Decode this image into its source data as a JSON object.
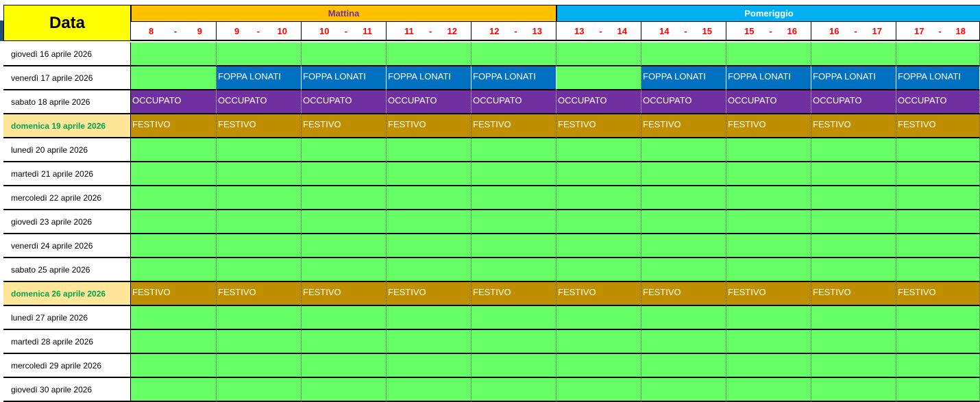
{
  "header": {
    "data_label": "Data",
    "groups": [
      {
        "label": "Mattina",
        "bg": "#ffc000",
        "color": "#7030a0"
      },
      {
        "label": "Pomeriggio",
        "bg": "#00b0f0",
        "color": "#ffffff"
      }
    ],
    "hours": [
      {
        "from": "8",
        "sep": "-",
        "to": "9"
      },
      {
        "from": "9",
        "sep": "-",
        "to": "10"
      },
      {
        "from": "10",
        "sep": "-",
        "to": "11"
      },
      {
        "from": "11",
        "sep": "-",
        "to": "12"
      },
      {
        "from": "12",
        "sep": "-",
        "to": "13"
      },
      {
        "from": "13",
        "sep": "-",
        "to": "14"
      },
      {
        "from": "14",
        "sep": "-",
        "to": "15"
      },
      {
        "from": "15",
        "sep": "-",
        "to": "16"
      },
      {
        "from": "16",
        "sep": "-",
        "to": "17"
      },
      {
        "from": "17",
        "sep": "-",
        "to": "18"
      }
    ]
  },
  "status_colors": {
    "free": "#66ff66",
    "booked": "#0070c0",
    "busy": "#7030a0",
    "holiday": "#bf8f00"
  },
  "rows": [
    {
      "date": "giovedì 16 aprile 2026",
      "holiday": false,
      "cells": [
        "",
        "",
        "",
        "",
        "",
        "",
        "",
        "",
        "",
        ""
      ]
    },
    {
      "date": "venerdì 17 aprile 2026",
      "holiday": false,
      "cells": [
        "",
        "FOPPA LONATI",
        "FOPPA LONATI",
        "FOPPA LONATI",
        "FOPPA LONATI",
        "",
        "FOPPA LONATI",
        "FOPPA LONATI",
        "FOPPA LONATI",
        "FOPPA LONATI"
      ]
    },
    {
      "date": "sabato 18 aprile 2026",
      "holiday": false,
      "cells": [
        "OCCUPATO",
        "OCCUPATO",
        "OCCUPATO",
        "OCCUPATO",
        "OCCUPATO",
        "OCCUPATO",
        "OCCUPATO",
        "OCCUPATO",
        "OCCUPATO",
        "OCCUPATO"
      ]
    },
    {
      "date": "domenica 19 aprile 2026",
      "holiday": true,
      "cells": [
        "FESTIVO",
        "FESTIVO",
        "FESTIVO",
        "FESTIVO",
        "FESTIVO",
        "FESTIVO",
        "FESTIVO",
        "FESTIVO",
        "FESTIVO",
        "FESTIVO"
      ]
    },
    {
      "date": "lunedì 20 aprile 2026",
      "holiday": false,
      "cells": [
        "",
        "",
        "",
        "",
        "",
        "",
        "",
        "",
        "",
        ""
      ]
    },
    {
      "date": "martedì 21 aprile 2026",
      "holiday": false,
      "cells": [
        "",
        "",
        "",
        "",
        "",
        "",
        "",
        "",
        "",
        ""
      ]
    },
    {
      "date": "mercoledì 22 aprile 2026",
      "holiday": false,
      "cells": [
        "",
        "",
        "",
        "",
        "",
        "",
        "",
        "",
        "",
        ""
      ]
    },
    {
      "date": "giovedì 23 aprile 2026",
      "holiday": false,
      "cells": [
        "",
        "",
        "",
        "",
        "",
        "",
        "",
        "",
        "",
        ""
      ]
    },
    {
      "date": "venerdì 24 aprile 2026",
      "holiday": false,
      "cells": [
        "",
        "",
        "",
        "",
        "",
        "",
        "",
        "",
        "",
        ""
      ]
    },
    {
      "date": "sabato 25 aprile 2026",
      "holiday": false,
      "cells": [
        "",
        "",
        "",
        "",
        "",
        "",
        "",
        "",
        "",
        ""
      ]
    },
    {
      "date": "domenica 26 aprile 2026",
      "holiday": true,
      "cells": [
        "FESTIVO",
        "FESTIVO",
        "FESTIVO",
        "FESTIVO",
        "FESTIVO",
        "FESTIVO",
        "FESTIVO",
        "FESTIVO",
        "FESTIVO",
        "FESTIVO"
      ]
    },
    {
      "date": "lunedì 27 aprile 2026",
      "holiday": false,
      "cells": [
        "",
        "",
        "",
        "",
        "",
        "",
        "",
        "",
        "",
        ""
      ]
    },
    {
      "date": "martedì 28 aprile 2026",
      "holiday": false,
      "cells": [
        "",
        "",
        "",
        "",
        "",
        "",
        "",
        "",
        "",
        ""
      ]
    },
    {
      "date": "mercoledì 29 aprile 2026",
      "holiday": false,
      "cells": [
        "",
        "",
        "",
        "",
        "",
        "",
        "",
        "",
        "",
        ""
      ]
    },
    {
      "date": "giovedì 30 aprile 2026",
      "holiday": false,
      "cells": [
        "",
        "",
        "",
        "",
        "",
        "",
        "",
        "",
        "",
        ""
      ]
    }
  ]
}
